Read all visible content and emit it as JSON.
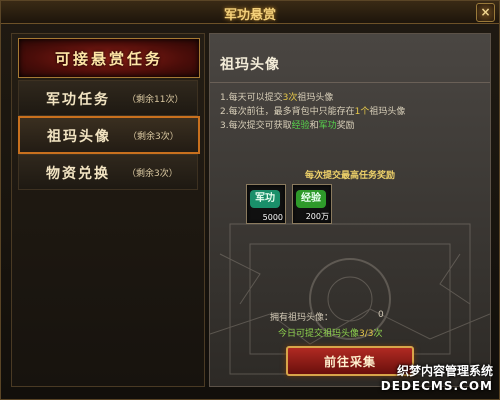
{
  "window": {
    "title": "军功悬赏",
    "close_glyph": "×"
  },
  "left_panel": {
    "header": "可接悬赏任务",
    "tasks": [
      {
        "name": "军功任务",
        "count": "（剩余11次）"
      },
      {
        "name": "祖玛头像",
        "count": "（剩余3次）"
      },
      {
        "name": "物资兑换",
        "count": "（剩余3次）"
      }
    ],
    "selected_index": 1
  },
  "detail": {
    "title": "祖玛头像",
    "rules": [
      {
        "prefix": "1.每天可以提交",
        "highlight": "3次",
        "suffix": "祖玛头像"
      },
      {
        "prefix": "2.每次前往，最多背包中只能存在",
        "highlight": "1个",
        "suffix": "祖玛头像"
      },
      {
        "prefix": "3.每次提交可获取",
        "highlight_green_1": "经验",
        "middle": "和",
        "highlight_green_2": "军功",
        "suffix": "奖励"
      }
    ],
    "rewards_title": "每次提交最高任务奖励",
    "rewards": [
      {
        "icon": "junggong-icon",
        "label": "军功",
        "qty": "5000",
        "color": "#1a8f6a"
      },
      {
        "icon": "exp-icon",
        "label": "经验",
        "qty": "200万",
        "color": "#2e9a2a"
      }
    ],
    "owned_label": "拥有祖玛头像：",
    "owned_value": "0",
    "today_prefix": "今日可提交祖玛头像",
    "today_value": "3/3",
    "today_suffix": "次",
    "goto_button": "前往采集"
  },
  "watermark": {
    "line1": "织梦内容管理系统",
    "line2": "DEDECMS.COM"
  }
}
